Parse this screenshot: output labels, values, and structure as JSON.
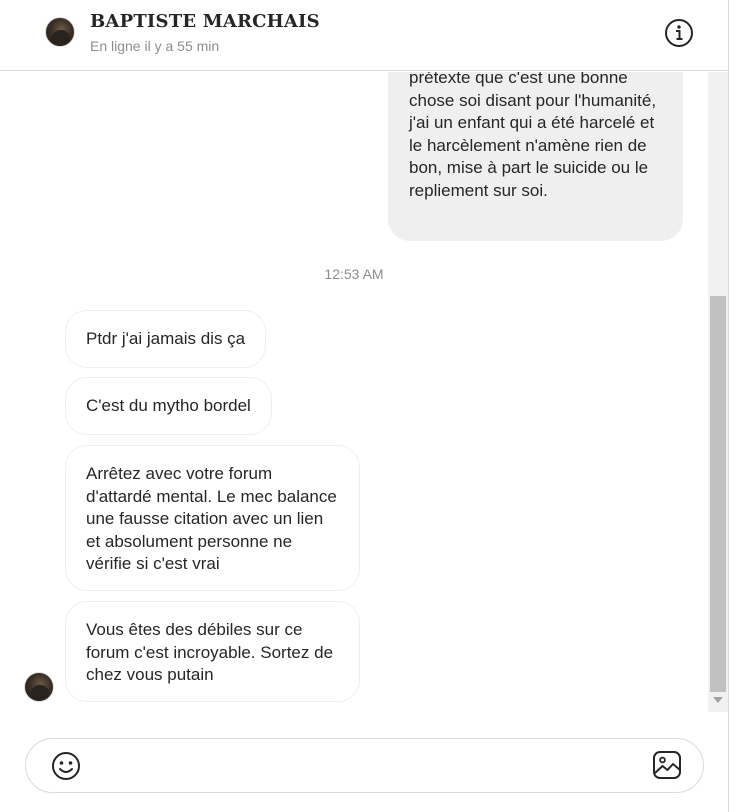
{
  "header": {
    "contact_name": "BAPTISTE MARCHAIS",
    "status": "En ligne il y a 55 min",
    "info_icon": "info-circle-icon"
  },
  "thread": {
    "outgoing": [
      {
        "text": "prétexte que c'est une bonne chose soi disant pour l'humanité, j'ai un enfant qui a été harcelé et le harcèlement n'amène rien de bon, mise à part le suicide ou le repliement sur soi."
      }
    ],
    "timestamp": "12:53 AM",
    "incoming": [
      {
        "text": "Ptdr j'ai jamais dis ça"
      },
      {
        "text": "C'est du mytho bordel"
      },
      {
        "text": "Arrêtez avec votre forum d'attardé mental. Le mec balance une fausse citation avec un lien et absolument personne ne vérifie si c'est vrai"
      },
      {
        "text": "Vous êtes des débiles sur ce forum c'est incroyable. Sortez de chez vous putain"
      }
    ]
  },
  "composer": {
    "placeholder": "",
    "emoji_icon": "emoji-smile-icon",
    "image_icon": "image-upload-icon"
  }
}
